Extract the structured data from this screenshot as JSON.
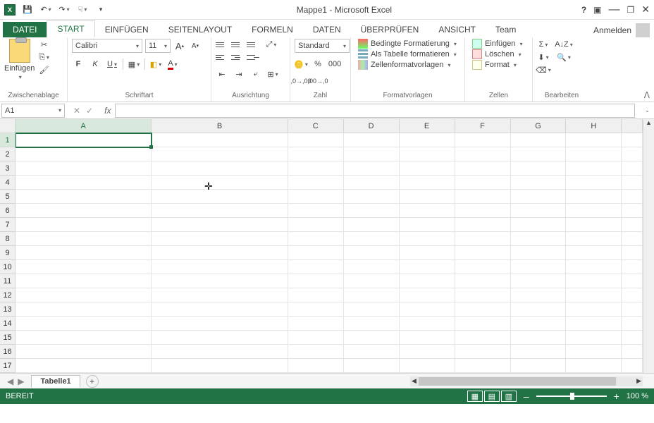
{
  "titlebar": {
    "app_title": "Mappe1 - Microsoft Excel"
  },
  "tabs": {
    "datei": "DATEI",
    "start": "START",
    "einfuegen": "EINFÜGEN",
    "seitenlayout": "SEITENLAYOUT",
    "formeln": "FORMELN",
    "daten": "DATEN",
    "ueberpruefen": "ÜBERPRÜFEN",
    "ansicht": "ANSICHT",
    "team": "Team",
    "anmelden": "Anmelden"
  },
  "ribbon": {
    "clipboard": {
      "paste": "Einfügen",
      "group": "Zwischenablage"
    },
    "font": {
      "family": "Calibri",
      "size": "11",
      "group": "Schriftart"
    },
    "align": {
      "group": "Ausrichtung"
    },
    "number": {
      "format": "Standard",
      "group": "Zahl"
    },
    "styles": {
      "cond": "Bedingte Formatierung",
      "table": "Als Tabelle formatieren",
      "cell": "Zellenformatvorlagen",
      "group": "Formatvorlagen"
    },
    "cells": {
      "insert": "Einfügen",
      "delete": "Löschen",
      "format": "Format",
      "group": "Zellen"
    },
    "edit": {
      "group": "Bearbeiten"
    }
  },
  "formula": {
    "name": "A1",
    "fx": "fx"
  },
  "sheet": {
    "columns": [
      "A",
      "B",
      "C",
      "D",
      "E",
      "F",
      "G",
      "H"
    ],
    "rows": [
      "1",
      "2",
      "3",
      "4",
      "5",
      "6",
      "7",
      "8",
      "9",
      "10",
      "11",
      "12",
      "13",
      "14",
      "15",
      "16",
      "17"
    ],
    "tab": "Tabelle1"
  },
  "status": {
    "state": "BEREIT",
    "zoom": "100 %"
  }
}
